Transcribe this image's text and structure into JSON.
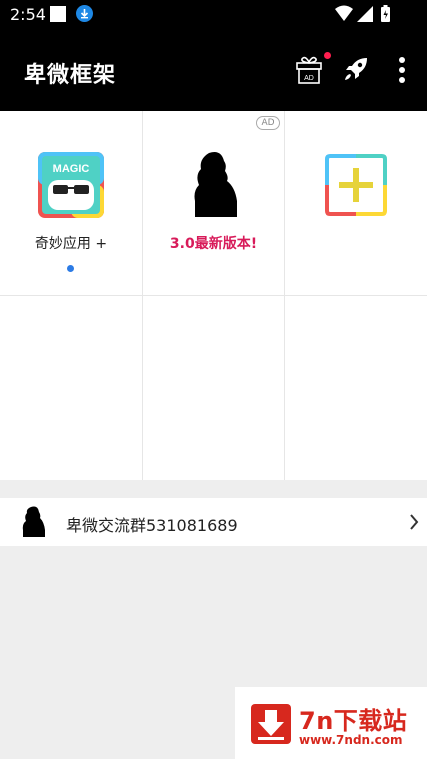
{
  "status_bar": {
    "time": "2:54",
    "icons": [
      "screen-icon",
      "download-icon",
      "wifi-icon",
      "signal-icon",
      "battery-icon"
    ]
  },
  "app_bar": {
    "title": "卑微框架",
    "gift_badge_text": "AD",
    "icons": [
      "gift-icon",
      "rocket-icon",
      "more-vert-icon"
    ],
    "notification_dot_color": "#ff1e4f"
  },
  "grid": {
    "cells": [
      {
        "label": "奇妙应用 +",
        "icon": "magic-app-icon",
        "icon_text": "MAGIC",
        "has_dot": true
      },
      {
        "label": "3.0最新版本!",
        "icon": "silhouette-icon",
        "ad_badge": "AD",
        "label_color": "#d81b5a"
      },
      {
        "label": "",
        "icon": "add-icon"
      }
    ]
  },
  "group_row": {
    "text": "卑微交流群531081689",
    "icon": "silhouette-avatar-icon"
  },
  "watermark": {
    "title": "7n下载站",
    "url": "www.7ndn.com",
    "color": "#d7281e"
  }
}
